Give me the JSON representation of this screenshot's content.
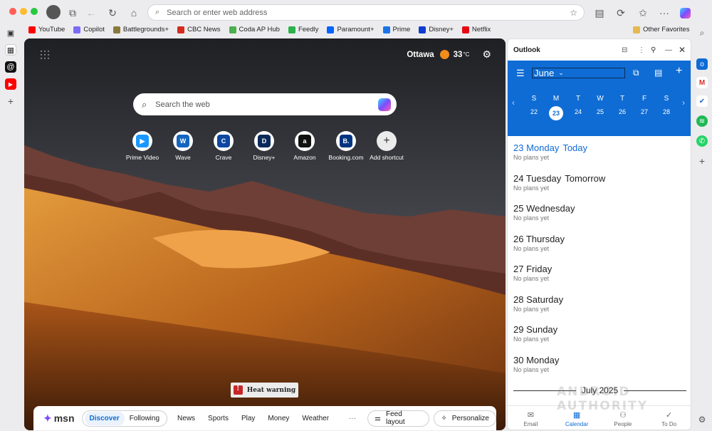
{
  "browser": {
    "address_placeholder": "Search or enter web address",
    "favorites": [
      {
        "label": "YouTube",
        "color": "#ff0000"
      },
      {
        "label": "Copilot",
        "color": "#7b6cf6"
      },
      {
        "label": "Battlegrounds+",
        "color": "#8a7a3a"
      },
      {
        "label": "CBC News",
        "color": "#d52b1e"
      },
      {
        "label": "Coda AP Hub",
        "color": "#4caf50"
      },
      {
        "label": "Feedly",
        "color": "#2bb24c"
      },
      {
        "label": "Paramount+",
        "color": "#0064ff"
      },
      {
        "label": "Prime",
        "color": "#1a73e8"
      },
      {
        "label": "Disney+",
        "color": "#113ccf"
      },
      {
        "label": "Netflix",
        "color": "#e50914"
      }
    ],
    "other_favorites": "Other Favorites"
  },
  "newtab": {
    "weather": {
      "city": "Ottawa",
      "temp": "33",
      "unit": "°C"
    },
    "search_placeholder": "Search the web",
    "shortcuts": [
      {
        "label": "Prime Video",
        "glyph": "▶",
        "color": "#1a98ff"
      },
      {
        "label": "Wave",
        "glyph": "W",
        "color": "#1565c0"
      },
      {
        "label": "Crave",
        "glyph": "C",
        "color": "#0d47a1"
      },
      {
        "label": "Disney+",
        "glyph": "D",
        "color": "#0b2a5b"
      },
      {
        "label": "Amazon",
        "glyph": "a",
        "color": "#111111"
      },
      {
        "label": "Booking.com",
        "glyph": "B.",
        "color": "#003580"
      },
      {
        "label": "Add shortcut",
        "glyph": "+",
        "color": "#444444"
      }
    ],
    "heat_warning": "Heat warning",
    "msn": {
      "logo": "msn",
      "tabs": [
        "Discover",
        "Following"
      ],
      "links": [
        "News",
        "Sports",
        "Play",
        "Money",
        "Weather"
      ],
      "more": "···",
      "feed_layout": "Feed layout",
      "personalize": "Personalize"
    }
  },
  "outlook": {
    "title": "Outlook",
    "month": "June",
    "weekdays": [
      "S",
      "M",
      "T",
      "W",
      "T",
      "F",
      "S"
    ],
    "week": [
      "22",
      "23",
      "24",
      "25",
      "26",
      "27",
      "28"
    ],
    "selected_day": "23",
    "days": [
      {
        "title": "23 Monday",
        "suffix": "Today",
        "sub": "No plans yet",
        "today": true
      },
      {
        "title": "24 Tuesday",
        "suffix": "Tomorrow",
        "sub": "No plans yet"
      },
      {
        "title": "25 Wednesday",
        "suffix": "",
        "sub": "No plans yet"
      },
      {
        "title": "26 Thursday",
        "suffix": "",
        "sub": "No plans yet"
      },
      {
        "title": "27 Friday",
        "suffix": "",
        "sub": "No plans yet"
      },
      {
        "title": "28 Saturday",
        "suffix": "",
        "sub": "No plans yet"
      },
      {
        "title": "29 Sunday",
        "suffix": "",
        "sub": "No plans yet"
      },
      {
        "title": "30 Monday",
        "suffix": "",
        "sub": "No plans yet"
      }
    ],
    "next_month": "July 2025",
    "nav": [
      {
        "label": "Email",
        "icon": "✉"
      },
      {
        "label": "Calendar",
        "icon": "▦",
        "active": true
      },
      {
        "label": "People",
        "icon": "⚇"
      },
      {
        "label": "To Do",
        "icon": "✓"
      }
    ]
  },
  "watermark": "ANDROID AUTHORITY"
}
